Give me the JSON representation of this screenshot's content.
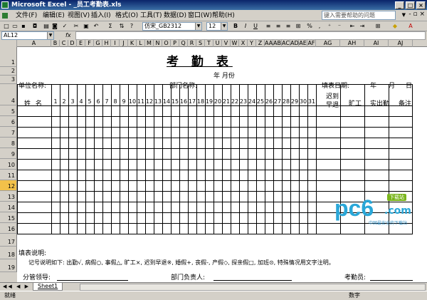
{
  "window": {
    "title": "Microsoft Excel - _员工考勤表.xls"
  },
  "menu": {
    "items": [
      "文件(F)",
      "编辑(E)",
      "视图(V)",
      "插入(I)",
      "格式(O)",
      "工具(T)",
      "数据(D)",
      "窗口(W)",
      "帮助(H)"
    ],
    "help_placeholder": "键入需要帮助的问题"
  },
  "toolbar": {
    "font_name": "仿宋_GB2312",
    "font_size": "12",
    "bold": "B",
    "italic": "I",
    "underline": "U",
    "sum": "Σ",
    "percent": "%"
  },
  "formula_bar": {
    "name_box": "AL12",
    "fx": "fx",
    "value": ""
  },
  "columns": [
    "A",
    "B",
    "C",
    "D",
    "E",
    "F",
    "G",
    "H",
    "I",
    "J",
    "K",
    "L",
    "M",
    "N",
    "O",
    "P",
    "Q",
    "R",
    "S",
    "T",
    "U",
    "V",
    "W",
    "X",
    "Y",
    "Z",
    "AA",
    "AB",
    "AC",
    "AD",
    "AE",
    "AF",
    "AG",
    "AH",
    "AI",
    "AJ"
  ],
  "rows": [
    "1",
    "2",
    "3",
    "4",
    "5",
    "6",
    "7",
    "8",
    "9",
    "10",
    "11",
    "12",
    "13",
    "14",
    "15",
    "16",
    "17",
    "18",
    "19"
  ],
  "selected_row": "12",
  "sheet": {
    "title": "考 勤 表",
    "year_month": "年    月份",
    "unit_label": "单位名称:",
    "dept_label": "部门名称:",
    "fill_date": "填表日期:",
    "year": "年",
    "month": "月",
    "day": "日",
    "name_header": "姓  名",
    "days": [
      "1",
      "2",
      "3",
      "4",
      "5",
      "6",
      "7",
      "8",
      "9",
      "10",
      "11",
      "12",
      "13",
      "14",
      "15",
      "16",
      "17",
      "18",
      "19",
      "20",
      "21",
      "22",
      "23",
      "24",
      "25",
      "26",
      "27",
      "28",
      "29",
      "30",
      "31"
    ],
    "late_header": "迟到\n早退",
    "absent_header": "旷工",
    "attend_header": "实出勤",
    "remark_header": "备注",
    "notes_label": "填表说明:",
    "notes_text": "记号说明如下: 出勤√, 病假○, 事假△, 旷工×, 迟到早退※, 婚假+, 丧假-, 产假◇, 探亲假□, 加班⊙, 特殊情况用文字注明。",
    "sign_manager": "分管领导:",
    "sign_dept": "部门负责人:",
    "sign_clerk": "考勤员:"
  },
  "tabs": {
    "sheet1": "Sheet1"
  },
  "status": {
    "left": "就绪",
    "right": "数字"
  },
  "watermark": {
    "brand": "pc6",
    "domain": ".com",
    "tagline": "中国最安全的下载站",
    "badge": "下载站"
  }
}
